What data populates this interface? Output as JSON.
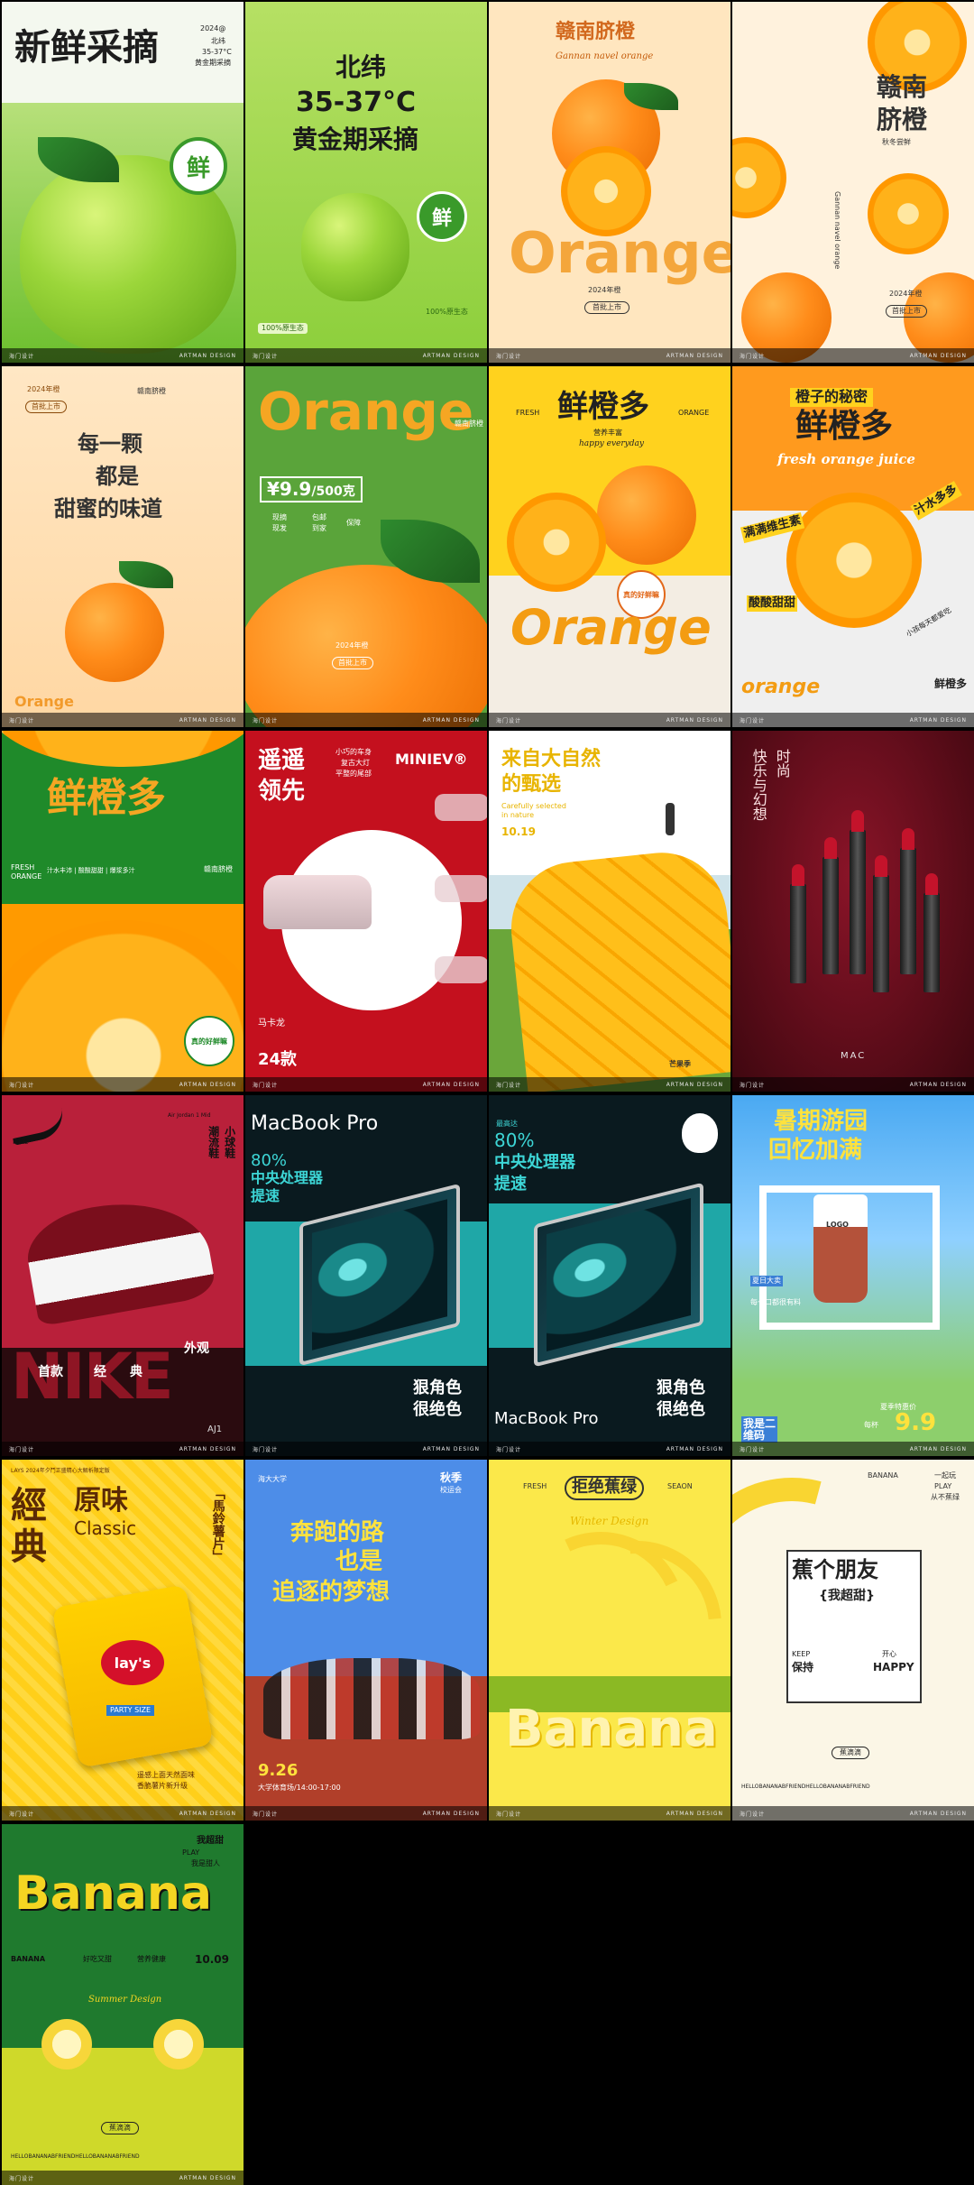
{
  "footer": {
    "left": "海门设计",
    "right": "ARTMAN DESIGN"
  },
  "colors": {
    "background": "#000000"
  },
  "posters": [
    {
      "id": "p1",
      "title": "新鲜采摘",
      "year": "2024@",
      "sub1": "北纬",
      "sub2": "35-37°C",
      "sub3": "黄金期采摘",
      "badge": "鲜"
    },
    {
      "id": "p2",
      "line1": "北纬",
      "line2": "35-37°C",
      "line3": "黄金期采摘",
      "badge": "鲜",
      "tag": "100%原生态",
      "tag2": "100%原生态"
    },
    {
      "id": "p3",
      "title": "赣南脐橙",
      "script": "Gannan navel orange",
      "big": "Orange",
      "year": "2024年橙",
      "label": "首批上市"
    },
    {
      "id": "p4",
      "title1": "赣南",
      "title2": "脐橙",
      "sub": "秋冬尝鲜",
      "en": "Gannan navel orange",
      "label": "首批上市",
      "year": "2024年橙"
    },
    {
      "id": "p5",
      "year": "2024年橙",
      "label": "首批上市",
      "side": "赣南脐橙",
      "line1": "每一颗",
      "line2": "都是",
      "line3": "甜蜜的味道",
      "brand": "Orange"
    },
    {
      "id": "p6",
      "big": "Orange",
      "price": "¥9.9",
      "unit": "/500克",
      "tags": [
        "现摘",
        "包邮",
        "现发",
        "到家",
        "保障"
      ],
      "label": "首批上市",
      "year": "2024年橙",
      "side": "赣南脐橙"
    },
    {
      "id": "p7",
      "fresh": "FRESH",
      "title": "鲜橙多",
      "orange": "ORANGE",
      "sub": "营养丰富",
      "script": "happy everyday",
      "badge": "真的好鲜嘛",
      "big": "Orange"
    },
    {
      "id": "p8",
      "top": "橙子的秘密",
      "title": "鲜橙多",
      "script": "fresh orange juice",
      "left": "满满维生素",
      "right": "汁水多多",
      "bottom": "酸酸甜甜",
      "br": "小孩每天都爱吃",
      "brand": "orange",
      "brand2": "鲜橙多"
    },
    {
      "id": "p9",
      "title": "鲜橙多",
      "fresh": "FRESH",
      "orange": "ORANGE",
      "slogan": "汁水丰沛 | 酸酸甜甜 | 爆浆多汁",
      "side": "赣南脐橙",
      "badge": "真的好鲜嘛"
    },
    {
      "id": "p10",
      "title1": "遥遥",
      "title2": "领先",
      "model": "MINIEV®",
      "desc1": "小巧的车身",
      "desc2": "复古大灯",
      "desc3": "平整的尾部",
      "name": "马卡龙",
      "num": "24款"
    },
    {
      "id": "p11",
      "title1": "来自大自然",
      "title2": "的甄选",
      "en1": "Carefully selected",
      "en2": "in nature",
      "date": "10.19",
      "label": "芒果季"
    },
    {
      "id": "p12",
      "title1": "快乐与幻想",
      "title2": "时尚",
      "brand": "MAC"
    },
    {
      "id": "p13",
      "brand": "Nike",
      "side": "小球鞋",
      "side2": "潮流鞋",
      "top": "Air Jordan 1 Mid",
      "big": "NIKE",
      "line": [
        "首款",
        "经",
        "典",
        "外观"
      ],
      "model": "AJ1"
    },
    {
      "id": "p14",
      "title": "MacBook Pro",
      "percent": "80%",
      "sub1": "中央处理器",
      "sub2": "提速",
      "right1": "狠角色",
      "right2": "很绝色"
    },
    {
      "id": "p15",
      "percent": "80%",
      "sub1": "中央处理器",
      "sub2": "提速",
      "title": "MacBook Pro",
      "right1": "狠角色",
      "right2": "很绝色",
      "small": "最高达"
    },
    {
      "id": "p16",
      "title1": "暑期游园",
      "title2": "回忆加满",
      "logo": "LOGO",
      "tag": "我是二维码",
      "price": "9.9",
      "price_label": "每杯",
      "promo": "夏季特惠价",
      "sticker": "夏日大卖",
      "sub": "每一口都很有料"
    },
    {
      "id": "p17",
      "top": "LAYS 2024年夕鬥正盛精心大解析限定版",
      "big1": "經",
      "big2": "典",
      "title": "原味",
      "en": "Classic",
      "side": "「馬鈴薯片」",
      "brand": "lay's",
      "pack": "PARTY SIZE",
      "bottom1": "遥感上面天然面味",
      "bottom2": "香脆薯片新升级"
    },
    {
      "id": "p18",
      "logo": "海大大学",
      "season": "秋季",
      "event": "校运会",
      "line1": "奔跑的路",
      "line2": "也是",
      "line3": "追逐的梦想",
      "date": "9.26",
      "place": "大学体育场/14:00-17:00"
    },
    {
      "id": "p19",
      "fresh": "FRESH",
      "title": "拒绝蕉绿",
      "season": "SEAON",
      "script": "Winter Design",
      "big": "Banana"
    },
    {
      "id": "p20",
      "brand": "BANANA",
      "r1": "一起玩",
      "r2": "PLAY",
      "r3": "从不蕉绿",
      "title": "蕉个朋友",
      "sub": "{我超甜}",
      "keep": "KEEP",
      "keep_cn": "保持",
      "happy": "开心",
      "happy_en": "HAPPY",
      "label": "蕉滴滴",
      "bottom": "HELLOBANANABFRIENDHELLOBANANABFRIEND"
    },
    {
      "id": "p21",
      "top1": "我超甜",
      "top2": "PLAY",
      "top3": "我是甜人",
      "big": "Banana",
      "left": "BANANA",
      "mid": "好吃又甜",
      "mid2": "营养健康",
      "date": "10.09",
      "script": "Summer Design",
      "label": "蕉滴滴",
      "bottom": "HELLOBANANABFRIENDHELLOBANANABFRIEND"
    }
  ]
}
